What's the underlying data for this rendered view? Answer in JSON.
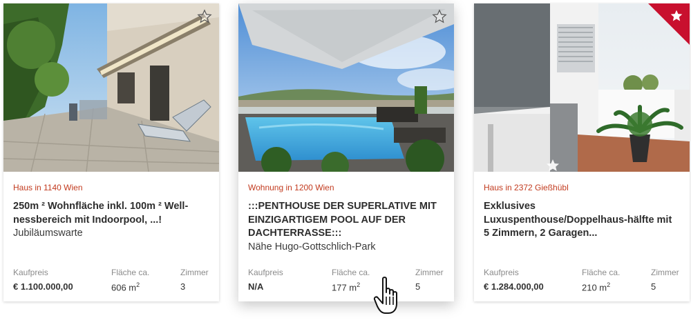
{
  "listings": [
    {
      "type": "Haus in 1140 Wien",
      "title": "250m ² Wohnfläche inkl. 100m ² Well-nessbereich mit Indoorpool, ...!",
      "subtitle": "Jubiläumswarte",
      "price_label": "Kaufpreis",
      "price": "€ 1.100.000,00",
      "area_label": "Fläche ca.",
      "area": "606 m",
      "area_sup": "2",
      "rooms_label": "Zimmer",
      "rooms": "3",
      "favorite": false,
      "image": "terrace-with-loungers"
    },
    {
      "type": "Wohnung in 1200 Wien",
      "title": ":::PENTHOUSE DER SUPERLATIVE MIT EINZIGARTIGEM POOL AUF DER DACHTERRASSE:::",
      "subtitle": "Nähe Hugo-Gottschlich-Park",
      "price_label": "Kaufpreis",
      "price": "N/A",
      "area_label": "Fläche ca.",
      "area": "177 m",
      "area_sup": "2",
      "rooms_label": "Zimmer",
      "rooms": "5",
      "favorite": false,
      "image": "rooftop-pool-city-view"
    },
    {
      "type": "Haus in 2372 Gießhübl",
      "title": "Exklusives Luxuspenthouse/Doppelhaus-hälfte mit 5 Zimmern, 2 Garagen...",
      "subtitle": "",
      "price_label": "Kaufpreis",
      "price": "€ 1.284.000,00",
      "area_label": "Fläche ca.",
      "area": "210 m",
      "area_sup": "2",
      "rooms_label": "Zimmer",
      "rooms": "5",
      "favorite": true,
      "image": "modern-house-terrace-palm"
    }
  ],
  "colors": {
    "accent": "#c8102e",
    "type_text": "#c23a1e",
    "label_gray": "#8a8a8a"
  },
  "icons": {
    "favorite": "star-icon",
    "cursor": "hand-pointer-icon"
  }
}
